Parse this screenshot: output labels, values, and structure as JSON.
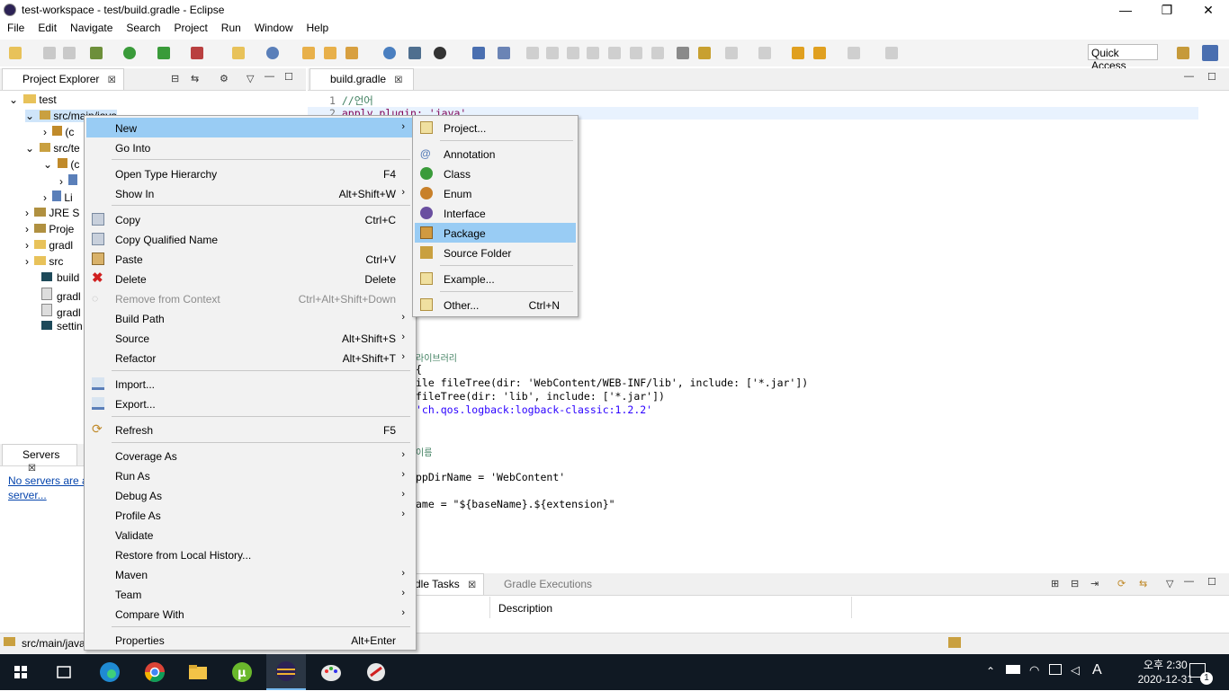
{
  "window": {
    "title": "test-workspace - test/build.gradle - Eclipse",
    "minimize": "—",
    "maximize": "❐",
    "close": "✕"
  },
  "menubar": [
    "File",
    "Edit",
    "Navigate",
    "Search",
    "Project",
    "Run",
    "Window",
    "Help"
  ],
  "toolbar": {
    "quick_access": "Quick Access"
  },
  "project_explorer": {
    "tab_label": "Project Explorer",
    "close_glyph": "☒",
    "items": [
      {
        "label": "test"
      },
      {
        "label": "src/main/java"
      },
      {
        "label": "(c"
      },
      {
        "label": "src/te"
      },
      {
        "label": "(c"
      },
      {
        "label": ""
      },
      {
        "label": "Li"
      },
      {
        "label": "JRE S"
      },
      {
        "label": "Proje"
      },
      {
        "label": "gradl"
      },
      {
        "label": "src"
      },
      {
        "label": "build"
      },
      {
        "label": "gradl"
      },
      {
        "label": "gradl"
      },
      {
        "label": "settin"
      }
    ]
  },
  "servers": {
    "tab_label": "Servers",
    "link_line1": "No servers are a",
    "link_line2": "server..."
  },
  "editor": {
    "tab_label": "build.gradle",
    "lines": [
      {
        "num": "1",
        "text": "//언어"
      },
      {
        "num": "2",
        "text": "apply plugin: 'java'"
      }
    ],
    "visible_fragments": [
      "라이브러리",
      "{",
      "ile fileTree(dir: 'WebContent/WEB-INF/lib', include: ['*.jar'])",
      "fileTree(dir: 'lib', include: ['*.jar'])",
      "'ch.qos.logback:logback-classic:1.2.2'",
      "이름",
      "ppDirName = 'WebContent'",
      "ame = \"${baseName}.${extension}\""
    ]
  },
  "bottom_panel": {
    "tab1": "dle Tasks",
    "tab2": "Gradle Executions",
    "col_description": "Description"
  },
  "status_bar": {
    "selection": "src/main/java"
  },
  "context_menu": {
    "items": [
      {
        "label": "New",
        "shortcut": "",
        "submenu": true,
        "highlighted": true
      },
      {
        "label": "Go Into",
        "shortcut": ""
      },
      {
        "label": "Open Type Hierarchy",
        "shortcut": "F4"
      },
      {
        "label": "Show In",
        "shortcut": "Alt+Shift+W",
        "submenu": true
      },
      {
        "label": "Copy",
        "shortcut": "Ctrl+C",
        "icon": "copy-icon"
      },
      {
        "label": "Copy Qualified Name",
        "shortcut": "",
        "icon": "copy-qualified-icon"
      },
      {
        "label": "Paste",
        "shortcut": "Ctrl+V",
        "icon": "paste-icon"
      },
      {
        "label": "Delete",
        "shortcut": "Delete",
        "icon": "delete-icon"
      },
      {
        "label": "Remove from Context",
        "shortcut": "Ctrl+Alt+Shift+Down",
        "disabled": true,
        "icon": "remove-context-icon"
      },
      {
        "label": "Build Path",
        "shortcut": "",
        "submenu": true
      },
      {
        "label": "Source",
        "shortcut": "Alt+Shift+S",
        "submenu": true
      },
      {
        "label": "Refactor",
        "shortcut": "Alt+Shift+T",
        "submenu": true
      },
      {
        "label": "Import...",
        "shortcut": "",
        "icon": "import-icon"
      },
      {
        "label": "Export...",
        "shortcut": "",
        "icon": "export-icon"
      },
      {
        "label": "Refresh",
        "shortcut": "F5",
        "icon": "refresh-icon"
      },
      {
        "label": "Coverage As",
        "shortcut": "",
        "submenu": true
      },
      {
        "label": "Run As",
        "shortcut": "",
        "submenu": true
      },
      {
        "label": "Debug As",
        "shortcut": "",
        "submenu": true
      },
      {
        "label": "Profile As",
        "shortcut": "",
        "submenu": true
      },
      {
        "label": "Validate",
        "shortcut": ""
      },
      {
        "label": "Restore from Local History...",
        "shortcut": ""
      },
      {
        "label": "Maven",
        "shortcut": "",
        "submenu": true
      },
      {
        "label": "Team",
        "shortcut": "",
        "submenu": true
      },
      {
        "label": "Compare With",
        "shortcut": "",
        "submenu": true
      },
      {
        "label": "Properties",
        "shortcut": "Alt+Enter"
      }
    ]
  },
  "new_submenu": {
    "items": [
      {
        "label": "Project...",
        "shortcut": "",
        "icon": "new-project-icon"
      },
      {
        "label": "Annotation",
        "shortcut": "",
        "icon": "annotation-icon"
      },
      {
        "label": "Class",
        "shortcut": "",
        "icon": "class-icon"
      },
      {
        "label": "Enum",
        "shortcut": "",
        "icon": "enum-icon"
      },
      {
        "label": "Interface",
        "shortcut": "",
        "icon": "interface-icon"
      },
      {
        "label": "Package",
        "shortcut": "",
        "icon": "package-icon",
        "highlighted": true
      },
      {
        "label": "Source Folder",
        "shortcut": "",
        "icon": "source-folder-icon"
      },
      {
        "label": "Example...",
        "shortcut": "",
        "icon": "example-icon"
      },
      {
        "label": "Other...",
        "shortcut": "Ctrl+N",
        "icon": "other-icon"
      }
    ]
  },
  "taskbar": {
    "time": "오후 2:30",
    "date": "2020-12-31",
    "ime": "A",
    "notification_count": "1"
  },
  "colors": {
    "menu_highlight": "#99ccf4",
    "taskbar": "#101923",
    "keyword": "#7f0055",
    "string": "#2a00ff",
    "comment": "#3f7f5f"
  }
}
